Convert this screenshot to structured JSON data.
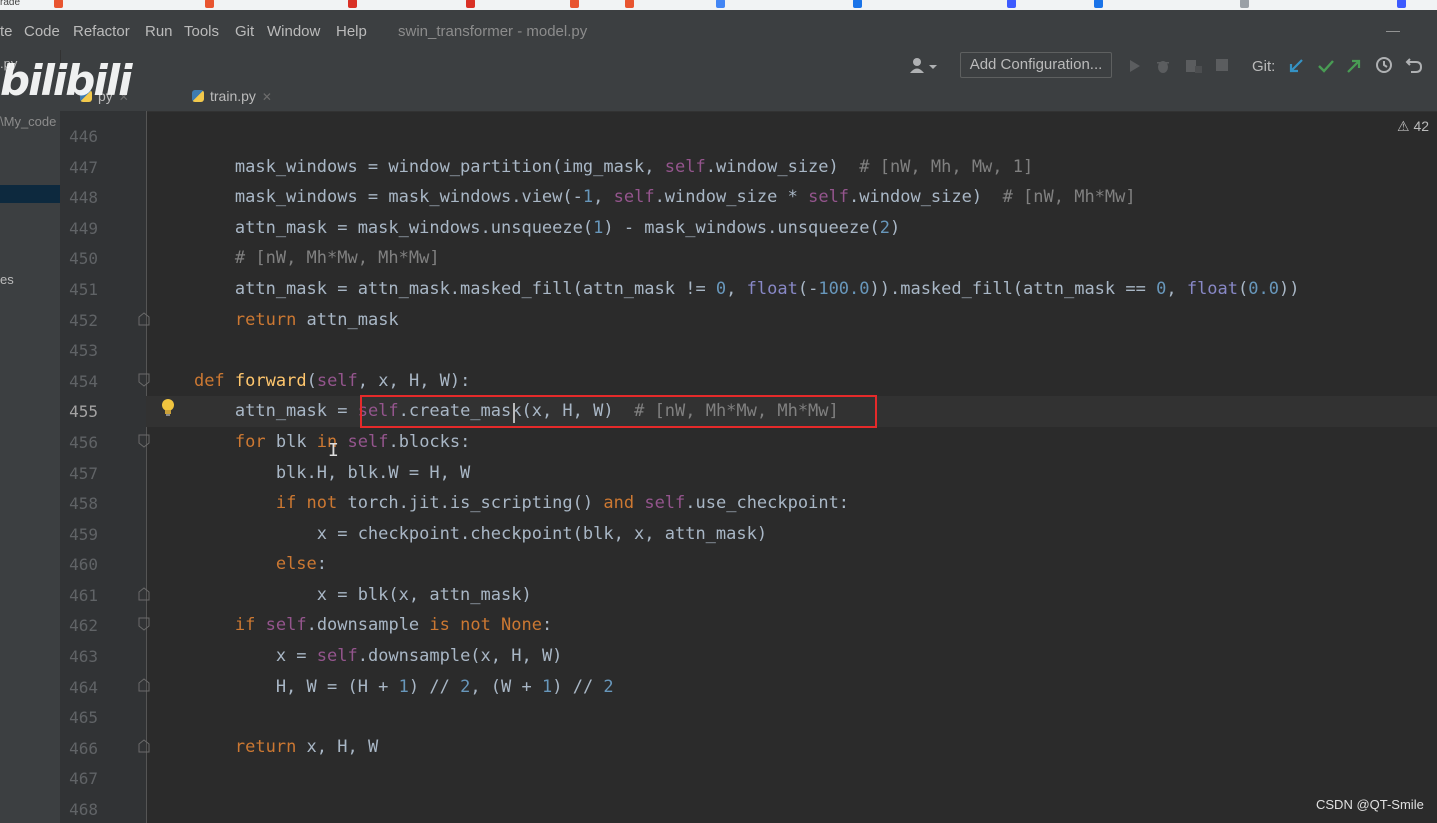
{
  "menu": {
    "items": [
      {
        "label": "te"
      },
      {
        "label": "Code"
      },
      {
        "label": "Refactor"
      },
      {
        "label": "Run"
      },
      {
        "label": "Tools"
      },
      {
        "label": "Git"
      },
      {
        "label": "Window"
      },
      {
        "label": "Help"
      }
    ],
    "window_title": "swin_transformer - model.py",
    "minimize": "—"
  },
  "toolbar": {
    "add_configuration": "Add Configuration...",
    "git_label": "Git:"
  },
  "tabs": [
    {
      "label": "py"
    },
    {
      "label": "train.py"
    }
  ],
  "sidebar": {
    "file_frag": ".py",
    "path_frag": "\\My_code",
    "item_frag": "es"
  },
  "overlay": {
    "logo_text": "bilibili",
    "watermark": "CSDN @QT-Smile"
  },
  "editor": {
    "warning_count": "42",
    "current_line": 455,
    "line_numbers": [
      "446",
      "447",
      "448",
      "449",
      "450",
      "451",
      "452",
      "453",
      "454",
      "455",
      "456",
      "457",
      "458",
      "459",
      "460",
      "461",
      "462",
      "463",
      "464",
      "465",
      "466",
      "467",
      "468"
    ]
  },
  "colors": {
    "editor_bg": "#2b2b2b",
    "keyword": "#cc7832",
    "self": "#94558d",
    "number": "#6897bb",
    "comment": "#808080",
    "function": "#ffc66d",
    "highlight_box": "#e52a2a"
  }
}
